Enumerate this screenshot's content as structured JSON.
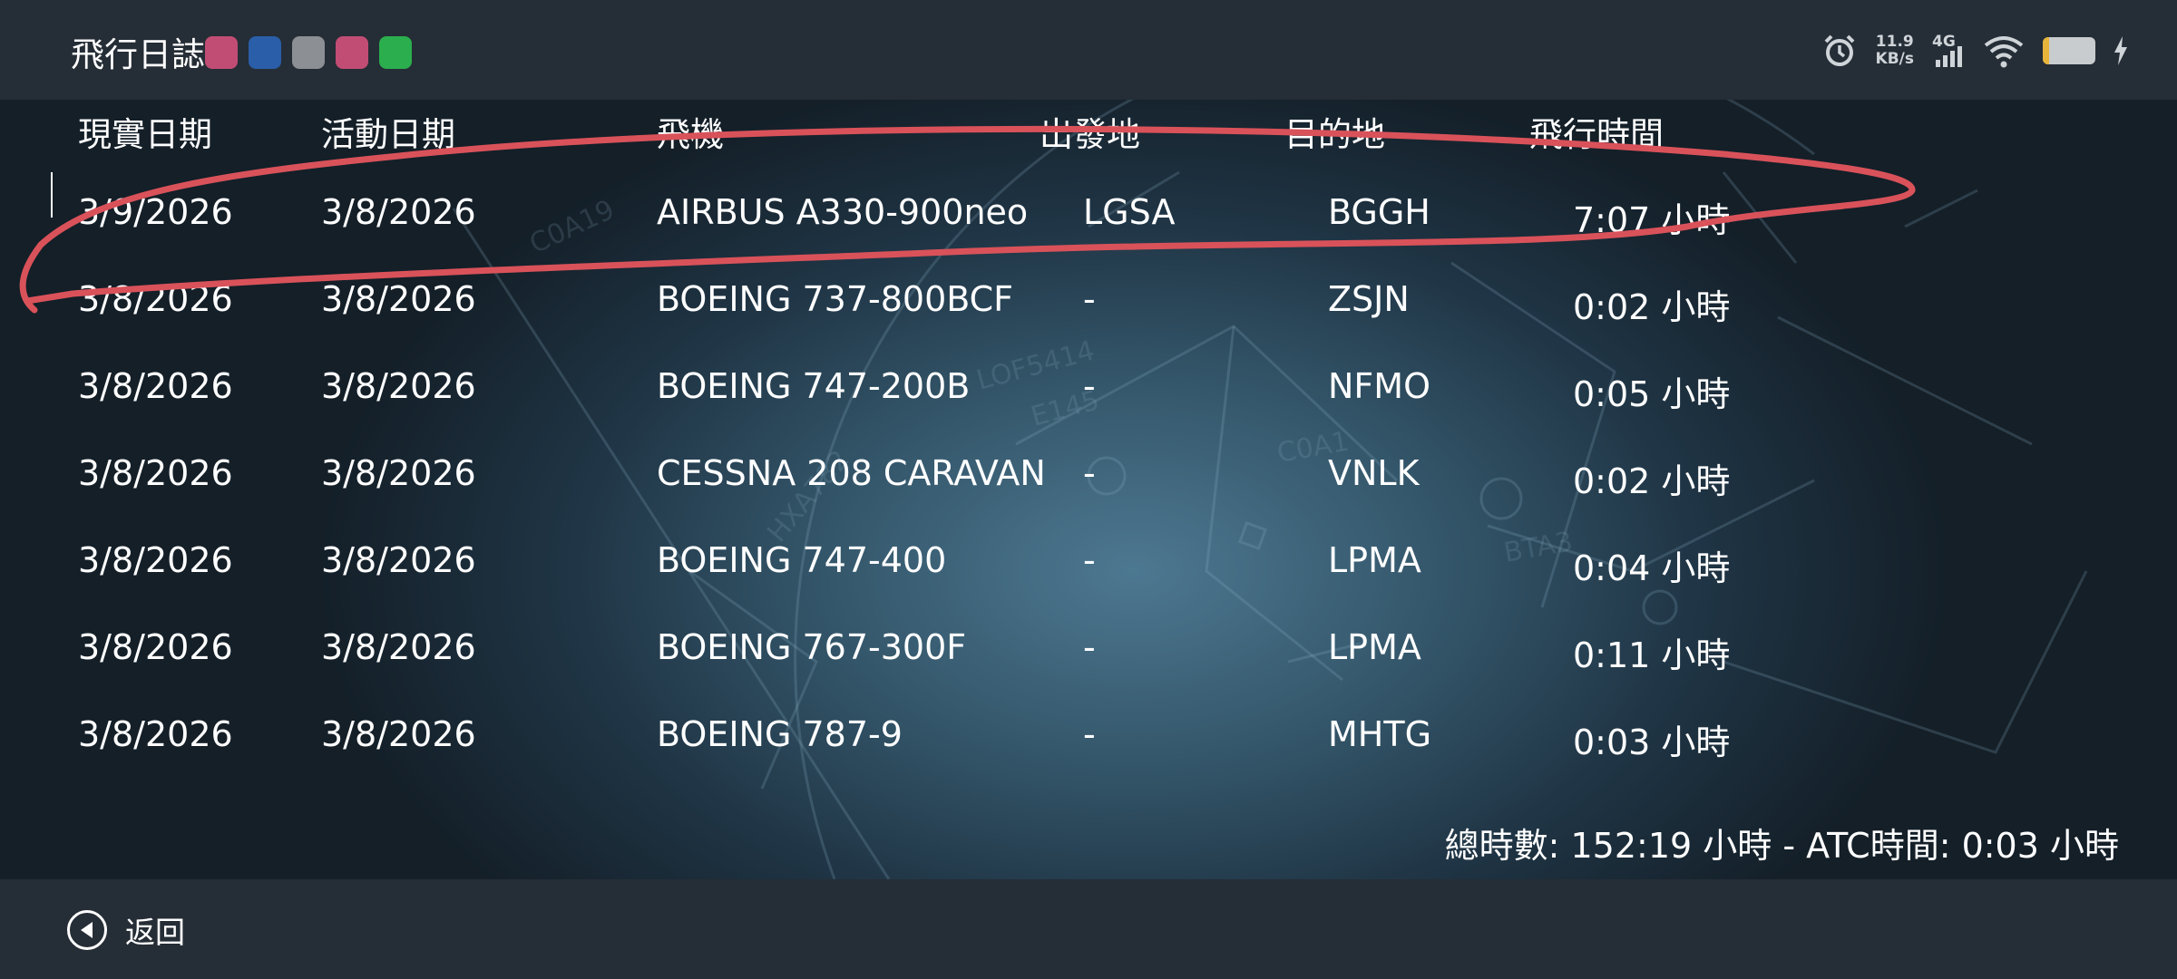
{
  "app": {
    "title": "飛行日誌"
  },
  "status_bar": {
    "net_speed_value": "11.9",
    "net_speed_unit": "KB/s",
    "network": "4G",
    "battery_level": 0.12
  },
  "columns": [
    "現實日期",
    "活動日期",
    "飛機",
    "出發地",
    "目的地",
    "飛行時間"
  ],
  "rows": [
    {
      "real_date": "3/9/2026",
      "activity_date": "3/8/2026",
      "aircraft": "AIRBUS A330-900neo",
      "departure": "LGSA",
      "destination": "BGGH",
      "flight_time": "7:07 小時"
    },
    {
      "real_date": "3/8/2026",
      "activity_date": "3/8/2026",
      "aircraft": "BOEING 737-800BCF",
      "departure": "-",
      "destination": "ZSJN",
      "flight_time": "0:02 小時"
    },
    {
      "real_date": "3/8/2026",
      "activity_date": "3/8/2026",
      "aircraft": "BOEING 747-200B",
      "departure": "-",
      "destination": "NFMO",
      "flight_time": "0:05 小時"
    },
    {
      "real_date": "3/8/2026",
      "activity_date": "3/8/2026",
      "aircraft": "CESSNA 208 CARAVAN",
      "departure": "-",
      "destination": "VNLK",
      "flight_time": "0:02 小時"
    },
    {
      "real_date": "3/8/2026",
      "activity_date": "3/8/2026",
      "aircraft": "BOEING 747-400",
      "departure": "-",
      "destination": "LPMA",
      "flight_time": "0:04 小時"
    },
    {
      "real_date": "3/8/2026",
      "activity_date": "3/8/2026",
      "aircraft": "BOEING 767-300F",
      "departure": "-",
      "destination": "LPMA",
      "flight_time": "0:11 小時"
    },
    {
      "real_date": "3/8/2026",
      "activity_date": "3/8/2026",
      "aircraft": "BOEING 787-9",
      "departure": "-",
      "destination": "MHTG",
      "flight_time": "0:03 小時"
    }
  ],
  "summary": "總時數: 152:19 小時 - ATC時間:  0:03 小時",
  "footer": {
    "back_label": "返回"
  },
  "colors": {
    "annotation": "#d9525a",
    "bar_bg": "#252d36"
  }
}
